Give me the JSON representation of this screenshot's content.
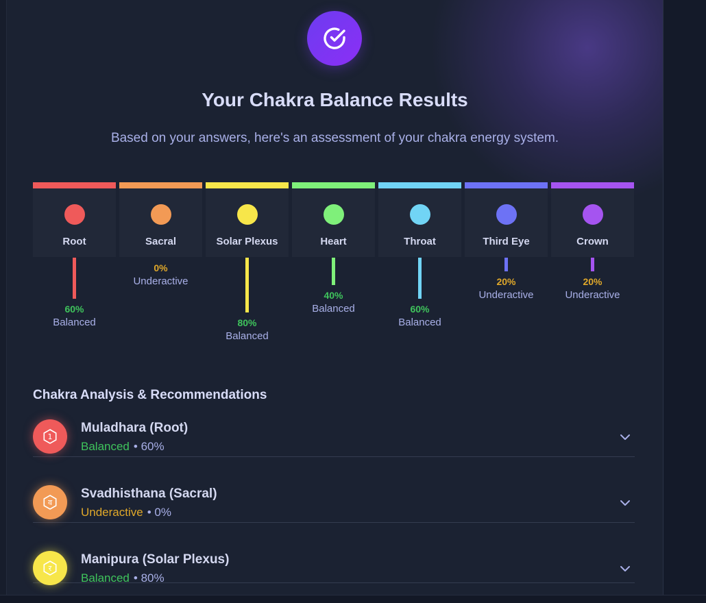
{
  "header": {
    "title": "Your Chakra Balance Results",
    "subtitle": "Based on your answers, here's an assessment of your chakra energy system."
  },
  "chakras": [
    {
      "name": "Root",
      "color": "#ef5a5a",
      "percent": 60,
      "percent_label": "60%",
      "status": "Balanced",
      "status_color": "green"
    },
    {
      "name": "Sacral",
      "color": "#f29a55",
      "percent": 0,
      "percent_label": "0%",
      "status": "Underactive",
      "status_color": "amber"
    },
    {
      "name": "Solar Plexus",
      "color": "#f7e64a",
      "percent": 80,
      "percent_label": "80%",
      "status": "Balanced",
      "status_color": "green"
    },
    {
      "name": "Heart",
      "color": "#7ff07a",
      "percent": 40,
      "percent_label": "40%",
      "status": "Balanced",
      "status_color": "green"
    },
    {
      "name": "Throat",
      "color": "#71d4f5",
      "percent": 60,
      "percent_label": "60%",
      "status": "Balanced",
      "status_color": "green"
    },
    {
      "name": "Third Eye",
      "color": "#6d72f5",
      "percent": 20,
      "percent_label": "20%",
      "status": "Underactive",
      "status_color": "amber"
    },
    {
      "name": "Crown",
      "color": "#a554f0",
      "percent": 20,
      "percent_label": "20%",
      "status": "Underactive",
      "status_color": "amber"
    }
  ],
  "analysis": {
    "title": "Chakra Analysis & Recommendations",
    "items": [
      {
        "name": "Muladhara (Root)",
        "status": "Balanced",
        "percent_label": "• 60%",
        "icon": "root-chakra-icon",
        "glyph": "1",
        "color": "#ef5a5a",
        "status_color": "green"
      },
      {
        "name": "Svadhisthana (Sacral)",
        "status": "Underactive",
        "percent_label": "• 0%",
        "icon": "sacral-chakra-icon",
        "glyph": "व",
        "color": "#f29a55",
        "status_color": "amber"
      },
      {
        "name": "Manipura (Solar Plexus)",
        "status": "Balanced",
        "percent_label": "• 80%",
        "icon": "solar-plexus-chakra-icon",
        "glyph": "र",
        "color": "#f7e64a",
        "status_color": "green"
      }
    ]
  },
  "colors": {
    "accent": "#7b35f2",
    "balanced": "#3fc45c",
    "underactive": "#e0a82a"
  }
}
